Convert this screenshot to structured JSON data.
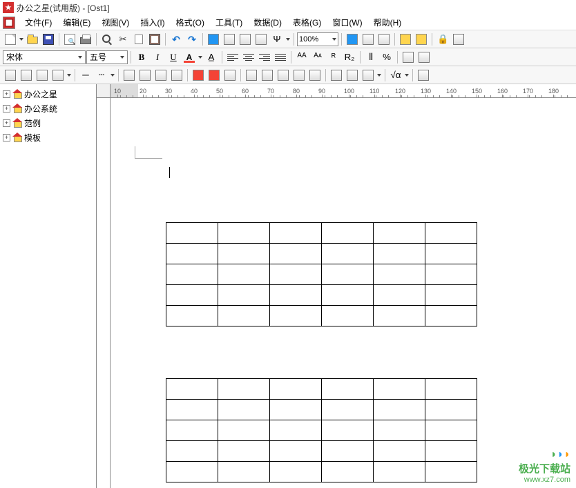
{
  "app": {
    "title": "办公之星(试用版) - [Ost1]"
  },
  "menu": {
    "items": [
      {
        "label": "文件(F)"
      },
      {
        "label": "编辑(E)"
      },
      {
        "label": "视图(V)"
      },
      {
        "label": "插入(I)"
      },
      {
        "label": "格式(O)"
      },
      {
        "label": "工具(T)"
      },
      {
        "label": "数据(D)"
      },
      {
        "label": "表格(G)"
      },
      {
        "label": "窗口(W)"
      },
      {
        "label": "帮助(H)"
      }
    ]
  },
  "toolbar1": {
    "zoom": "100%"
  },
  "toolbar2": {
    "font_name": "宋体",
    "font_size": "五号"
  },
  "sidebar": {
    "items": [
      {
        "label": "办公之星"
      },
      {
        "label": "办公系统"
      },
      {
        "label": "范例"
      },
      {
        "label": "模板"
      }
    ]
  },
  "ruler": {
    "marks": [
      10,
      20,
      30,
      40,
      50,
      60,
      70,
      80,
      90,
      100,
      110,
      120,
      130,
      140,
      150,
      160,
      170,
      180
    ]
  },
  "document": {
    "tables": [
      {
        "rows": 5,
        "cols": 6
      },
      {
        "rows": 5,
        "cols": 6
      }
    ]
  },
  "watermark": {
    "text": "极光下载站",
    "url": "www.xz7.com"
  }
}
